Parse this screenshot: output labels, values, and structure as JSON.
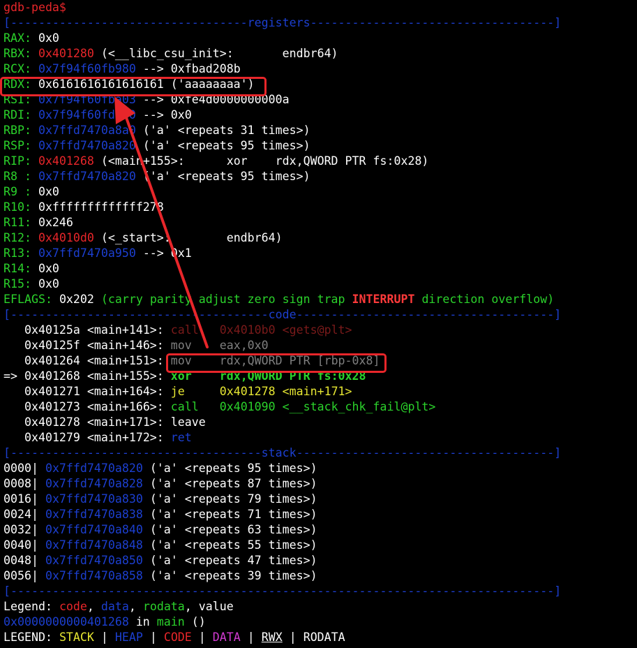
{
  "prompt": "gdb-peda$",
  "sections": {
    "registers": "[----------------------------------registers-----------------------------------]",
    "code": "[-------------------------------------code-------------------------------------]",
    "stack": "[------------------------------------stack-------------------------------------]",
    "end": "[------------------------------------------------------------------------------]"
  },
  "registers": [
    {
      "name": "RAX: ",
      "value": "0x0",
      "vclass": "white",
      "rest": ""
    },
    {
      "name": "RBX: ",
      "value": "0x401280",
      "vclass": "red",
      "rest": " (<__libc_csu_init>:       endbr64)"
    },
    {
      "name": "RCX: ",
      "value": "0x7f94f60fb980",
      "vclass": "blue",
      "rest": " --> 0xfbad208b"
    },
    {
      "name": "RDX: ",
      "value": "0x6161616161616161",
      "vclass": "white",
      "rest": " ('aaaaaaaa')"
    },
    {
      "name": "RSI: ",
      "value": "0x7f94f60fba03",
      "vclass": "blue",
      "rest": " --> 0xfe4d0000000000a"
    },
    {
      "name": "RDI: ",
      "value": "0x7f94f60fd4d0",
      "vclass": "blue",
      "rest": " --> 0x0"
    },
    {
      "name": "RBP: ",
      "value": "0x7ffd7470a8a0",
      "vclass": "blue",
      "rest": " ('a' <repeats 31 times>)"
    },
    {
      "name": "RSP: ",
      "value": "0x7ffd7470a820",
      "vclass": "blue",
      "rest": " ('a' <repeats 95 times>)"
    },
    {
      "name": "RIP: ",
      "value": "0x401268",
      "vclass": "red",
      "rest": " (<main+155>:      xor    rdx,QWORD PTR fs:0x28)"
    },
    {
      "name": "R8 : ",
      "value": "0x7ffd7470a820",
      "vclass": "blue",
      "rest": " ('a' <repeats 95 times>)"
    },
    {
      "name": "R9 : ",
      "value": "0x0",
      "vclass": "white",
      "rest": ""
    },
    {
      "name": "R10: ",
      "value": "0xfffffffffffff278",
      "vclass": "white",
      "rest": ""
    },
    {
      "name": "R11: ",
      "value": "0x246",
      "vclass": "white",
      "rest": ""
    },
    {
      "name": "R12: ",
      "value": "0x4010d0",
      "vclass": "red",
      "rest": " (<_start>:        endbr64)"
    },
    {
      "name": "R13: ",
      "value": "0x7ffd7470a950",
      "vclass": "blue",
      "rest": " --> 0x1"
    },
    {
      "name": "R14: ",
      "value": "0x0",
      "vclass": "white",
      "rest": ""
    },
    {
      "name": "R15: ",
      "value": "0x0",
      "vclass": "white",
      "rest": ""
    }
  ],
  "eflags": {
    "label": "EFLAGS: ",
    "value": "0x202",
    "open": " (carry parity adjust zero sign trap ",
    "interrupt": "INTERRUPT",
    "close": " direction overflow)"
  },
  "code": [
    {
      "marker": "   ",
      "addr": "0x40125a <main+141>: ",
      "mnem": "call   ",
      "ops": "0x4010b0 <gets@plt>",
      "style": "dim"
    },
    {
      "marker": "   ",
      "addr": "0x40125f <main+146>: ",
      "mnem": "mov    ",
      "ops": "eax,0x0",
      "style": "gray"
    },
    {
      "marker": "   ",
      "addr": "0x401264 <main+151>: ",
      "mnem": "mov    ",
      "ops": "rdx,QWORD PTR [rbp-0x8]",
      "style": "gray"
    },
    {
      "marker": "=> ",
      "addr": "0x401268 <main+155>: ",
      "mnem": "xor    ",
      "ops": "rdx,QWORD PTR fs:0x28",
      "style": "current"
    },
    {
      "marker": "   ",
      "addr": "0x401271 <main+164>: ",
      "mnem": "je     ",
      "ops": "0x401278 <main+171>",
      "style": "je"
    },
    {
      "marker": "   ",
      "addr": "0x401273 <main+166>: ",
      "mnem": "call   ",
      "ops": "0x401090 <__stack_chk_fail@plt>",
      "style": "call"
    },
    {
      "marker": "   ",
      "addr": "0x401278 <main+171>: ",
      "mnem": "leave",
      "ops": "",
      "style": "plain"
    },
    {
      "marker": "   ",
      "addr": "0x401279 <main+172>: ",
      "mnem": "ret",
      "ops": "",
      "style": "ret"
    }
  ],
  "stack": [
    {
      "off": "0000| ",
      "addr": "0x7ffd7470a820",
      "val": " ('a' <repeats 95 times>)"
    },
    {
      "off": "0008| ",
      "addr": "0x7ffd7470a828",
      "val": " ('a' <repeats 87 times>)"
    },
    {
      "off": "0016| ",
      "addr": "0x7ffd7470a830",
      "val": " ('a' <repeats 79 times>)"
    },
    {
      "off": "0024| ",
      "addr": "0x7ffd7470a838",
      "val": " ('a' <repeats 71 times>)"
    },
    {
      "off": "0032| ",
      "addr": "0x7ffd7470a840",
      "val": " ('a' <repeats 63 times>)"
    },
    {
      "off": "0040| ",
      "addr": "0x7ffd7470a848",
      "val": " ('a' <repeats 55 times>)"
    },
    {
      "off": "0048| ",
      "addr": "0x7ffd7470a850",
      "val": " ('a' <repeats 47 times>)"
    },
    {
      "off": "0056| ",
      "addr": "0x7ffd7470a858",
      "val": " ('a' <repeats 39 times>)"
    }
  ],
  "legend": {
    "label": "Legend: ",
    "code": "code",
    "data": "data",
    "rodata": "rodata",
    "value": "value",
    "sep": ", "
  },
  "location": {
    "addr": "0x0000000000401268",
    "in": " in ",
    "func": "main",
    "args": " ()"
  },
  "legend2": {
    "label": "LEGEND: ",
    "stack": "STACK",
    "heap": "HEAP",
    "code": "CODE",
    "data": "DATA",
    "rwx": "RWX",
    "rodata": "RODATA",
    "bar": " | "
  },
  "colors": {
    "background": "#000000",
    "annotation": "#e8262a"
  }
}
